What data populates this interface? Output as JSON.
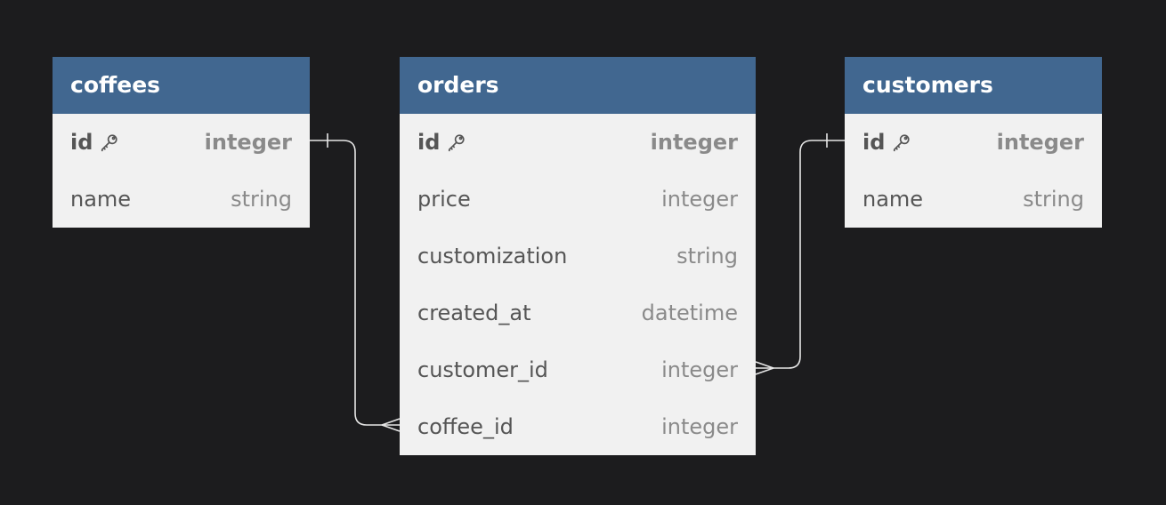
{
  "colors": {
    "background": "#1c1c1e",
    "header": "#416790",
    "table_body": "#f1f1f1",
    "connector": "#e6e6e6"
  },
  "tables": {
    "coffees": {
      "title": "coffees",
      "rows": [
        {
          "name": "id",
          "type": "integer",
          "primary_key": true,
          "icon": "key-icon"
        },
        {
          "name": "name",
          "type": "string"
        }
      ]
    },
    "orders": {
      "title": "orders",
      "rows": [
        {
          "name": "id",
          "type": "integer",
          "primary_key": true,
          "icon": "key-icon"
        },
        {
          "name": "price",
          "type": "integer"
        },
        {
          "name": "customization",
          "type": "string"
        },
        {
          "name": "created_at",
          "type": "datetime"
        },
        {
          "name": "customer_id",
          "type": "integer"
        },
        {
          "name": "coffee_id",
          "type": "integer"
        }
      ]
    },
    "customers": {
      "title": "customers",
      "rows": [
        {
          "name": "id",
          "type": "integer",
          "primary_key": true,
          "icon": "key-icon"
        },
        {
          "name": "name",
          "type": "string"
        }
      ]
    }
  },
  "relationships": [
    {
      "from": "coffees.id",
      "from_cardinality": "one",
      "to": "orders.coffee_id",
      "to_cardinality": "many"
    },
    {
      "from": "customers.id",
      "from_cardinality": "one",
      "to": "orders.customer_id",
      "to_cardinality": "many"
    }
  ]
}
